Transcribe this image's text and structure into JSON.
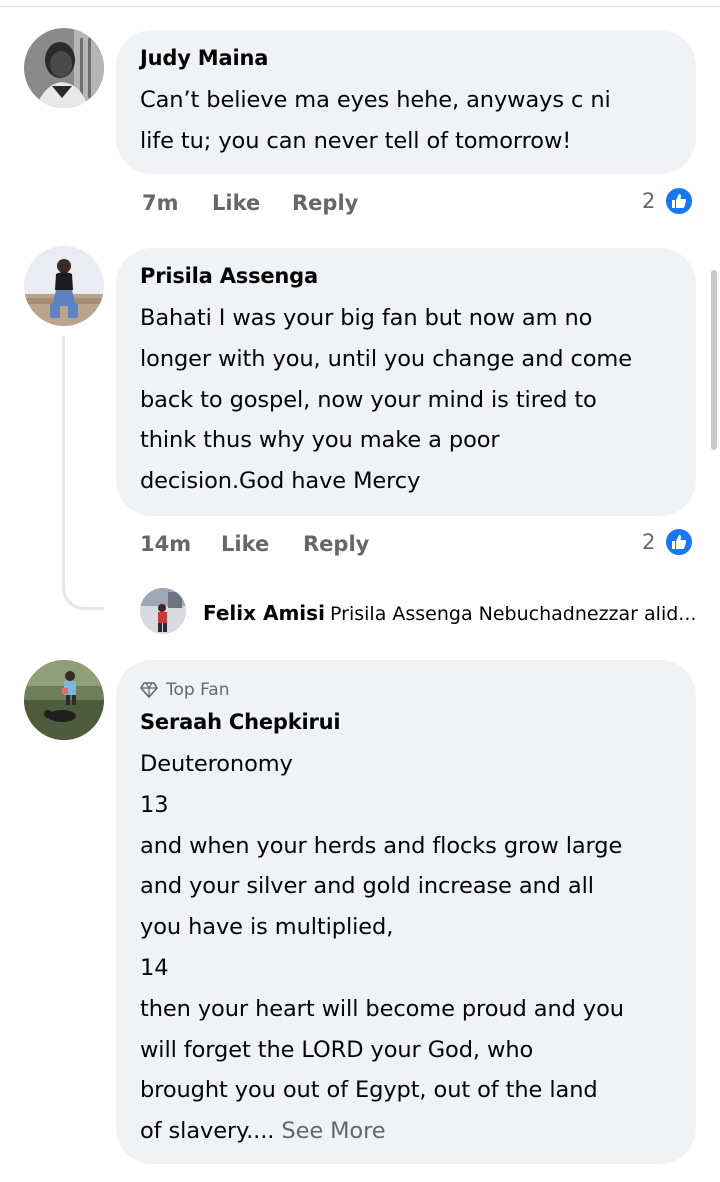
{
  "comments": [
    {
      "author": "Judy Maina",
      "text": "Can’t believe ma eyes hehe, anyways c ni\nlife tu; you can never tell of tomorrow!",
      "time": "7m",
      "like_label": "Like",
      "reply_label": "Reply",
      "reaction_count": "2"
    },
    {
      "author": "Prisila Assenga",
      "text": "Bahati I was your big fan but now am no\nlonger with you, until you change and come\nback to gospel, now your mind is tired to\nthink thus why you make a poor\ndecision.God have Mercy",
      "time": "14m",
      "like_label": "Like",
      "reply_label": "Reply",
      "reaction_count": "2",
      "reply_preview": {
        "author": "Felix Amisi",
        "text": "Prisila Assenga Nebuchadnezzar alid..."
      }
    },
    {
      "badge": "Top Fan",
      "author": "Seraah Chepkirui",
      "text": "Deuteronomy\n13\nand when your herds and flocks grow large\nand your silver and gold increase and all\nyou have is multiplied,\n14\nthen your heart will become proud and you\nwill forget the LORD your God, who\nbrought you out of Egypt, out of the land\nof slavery....",
      "see_more": "See More"
    }
  ],
  "colors": {
    "bubble": "#f0f2f5",
    "secondary_text": "#65676b",
    "like_blue": "#1877f2"
  },
  "icons": {
    "like": "thumbs-up-icon",
    "top_fan": "diamond-icon"
  }
}
